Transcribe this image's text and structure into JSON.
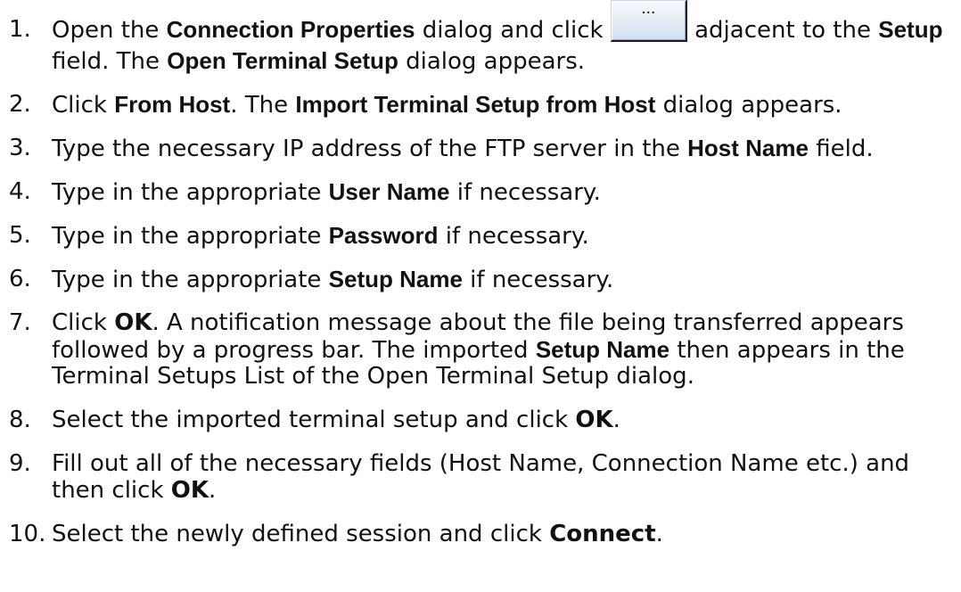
{
  "setup_button": {
    "label": "..."
  },
  "steps": [
    {
      "number": "1.",
      "lines": [
        [
          "Open the ",
          "Connection Properties",
          " dialog and click ",
          " adjacent to the ",
          "Setup"
        ],
        [
          "field. The ",
          "Open Terminal Setup",
          " dialog appears."
        ]
      ]
    },
    {
      "number": "2.",
      "lines": [
        [
          "Click ",
          "From Host",
          ". The ",
          "Import Terminal Setup from Host",
          " dialog appears."
        ]
      ]
    },
    {
      "number": "3.",
      "lines": [
        [
          "Type the necessary IP address of the FTP server in the ",
          "Host Name",
          " field."
        ]
      ]
    },
    {
      "number": "4.",
      "lines": [
        [
          "Type in the appropriate ",
          "User Name",
          " if necessary."
        ]
      ]
    },
    {
      "number": "5.",
      "lines": [
        [
          "Type in the appropriate ",
          "Password",
          " if necessary."
        ]
      ]
    },
    {
      "number": "6.",
      "lines": [
        [
          "Type in the appropriate ",
          "Setup Name",
          " if necessary."
        ]
      ]
    },
    {
      "number": "7.",
      "lines": [
        [
          "Click ",
          "OK",
          ". A notification message about the file being transferred appears"
        ],
        [
          "followed by a progress bar. The imported ",
          "Setup Name",
          " then appears in the"
        ],
        [
          "Terminal Setups List of the Open Terminal Setup dialog."
        ]
      ]
    },
    {
      "number": "8.",
      "lines": [
        [
          "Select the imported terminal setup and click ",
          "OK",
          "."
        ]
      ]
    },
    {
      "number": "9.",
      "lines": [
        [
          "Fill out all of the necessary fields (Host Name, Connection Name etc.) and"
        ],
        [
          "then click ",
          "OK",
          "."
        ]
      ]
    },
    {
      "number": "10.",
      "lines": [
        [
          "Select the newly defined session and click ",
          "Connect",
          "."
        ]
      ]
    }
  ]
}
